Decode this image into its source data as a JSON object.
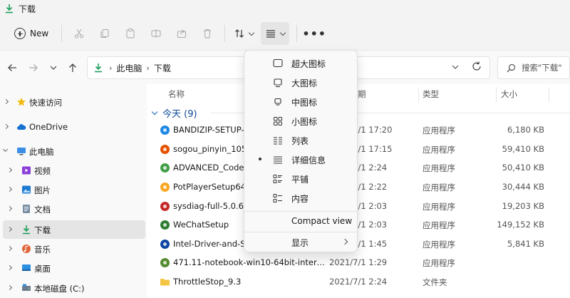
{
  "window": {
    "title": "下载"
  },
  "commandbar": {
    "new_label": "New",
    "icons": [
      "cut-icon",
      "copy-icon",
      "paste-icon",
      "rename-icon",
      "share-icon",
      "delete-icon"
    ],
    "sort_icon": "sort-icon",
    "view_icon": "view-details-icon",
    "more_label": "•••"
  },
  "address": {
    "crumbs": [
      "此电脑",
      "下载"
    ],
    "search_placeholder": "搜索\"下载\""
  },
  "sidebar": {
    "items": [
      {
        "label": "快速访问",
        "icon": "star-icon"
      },
      {
        "label": "OneDrive",
        "icon": "cloud-icon"
      },
      {
        "label": "此电脑",
        "icon": "pc-icon"
      },
      {
        "label": "视频",
        "icon": "video-folder-icon"
      },
      {
        "label": "图片",
        "icon": "pictures-folder-icon"
      },
      {
        "label": "文档",
        "icon": "documents-folder-icon"
      },
      {
        "label": "下载",
        "icon": "downloads-folder-icon"
      },
      {
        "label": "音乐",
        "icon": "music-folder-icon"
      },
      {
        "label": "桌面",
        "icon": "desktop-folder-icon"
      },
      {
        "label": "本地磁盘 (C:)",
        "icon": "drive-icon"
      }
    ]
  },
  "columns": {
    "name": "名称",
    "date_partial": "期",
    "type": "类型",
    "size": "大小"
  },
  "group": {
    "label": "今天 (9)"
  },
  "files": [
    {
      "name": "BANDIZIP-SETUP-S",
      "date": "2021/7/1 17:20",
      "type": "应用程序",
      "size": "6,180 KB",
      "icon": "bandizip-icon",
      "color": "#1e88e5"
    },
    {
      "name": "sogou_pinyin_105b",
      "date": "2021/7/1 17:15",
      "type": "应用程序",
      "size": "59,410 KB",
      "icon": "sogou-icon",
      "color": "#e65100"
    },
    {
      "name": "ADVANCED_Codec",
      "date": "2021/7/1 2:24",
      "type": "应用程序",
      "size": "50,410 KB",
      "icon": "codec-icon",
      "color": "#43a047"
    },
    {
      "name": "PotPlayerSetup64",
      "date": "2021/7/1 2:22",
      "type": "应用程序",
      "size": "30,444 KB",
      "icon": "potplayer-icon",
      "color": "#f9a825"
    },
    {
      "name": "sysdiag-full-5.0.62.",
      "date": "2021/7/1 2:03",
      "type": "应用程序",
      "size": "19,203 KB",
      "icon": "sysdiag-icon",
      "color": "#c62828"
    },
    {
      "name": "WeChatSetup",
      "date": "2021/7/1 2:03",
      "type": "应用程序",
      "size": "149,152 KB",
      "icon": "wechat-icon",
      "color": "#2e7d32"
    },
    {
      "name": "Intel-Driver-and-Su",
      "date": "2021/7/1 1:45",
      "type": "应用程序",
      "size": "5,841 KB",
      "icon": "intel-icon",
      "color": "#0d47a1"
    },
    {
      "name": "471.11-notebook-win10-64bit-interna...",
      "date": "2021/7/1 1:29",
      "type": "应用程序",
      "size": "",
      "icon": "nvidia-icon",
      "color": "#558b2f"
    },
    {
      "name": "ThrottleStop_9.3",
      "date": "2021/7/1 2:24",
      "type": "文件夹",
      "size": "",
      "icon": "folder-icon",
      "color": "#f4c542"
    }
  ],
  "view_menu": {
    "items": [
      {
        "label": "超大图标",
        "icon": "extra-large-icons-icon"
      },
      {
        "label": "大图标",
        "icon": "large-icons-icon"
      },
      {
        "label": "中图标",
        "icon": "medium-icons-icon"
      },
      {
        "label": "小图标",
        "icon": "small-icons-icon"
      },
      {
        "label": "列表",
        "icon": "list-icon"
      },
      {
        "label": "详细信息",
        "icon": "details-icon",
        "selected": true
      },
      {
        "label": "平铺",
        "icon": "tiles-icon"
      },
      {
        "label": "内容",
        "icon": "content-icon"
      }
    ],
    "compact_view": "Compact view",
    "show_label": "显示"
  }
}
